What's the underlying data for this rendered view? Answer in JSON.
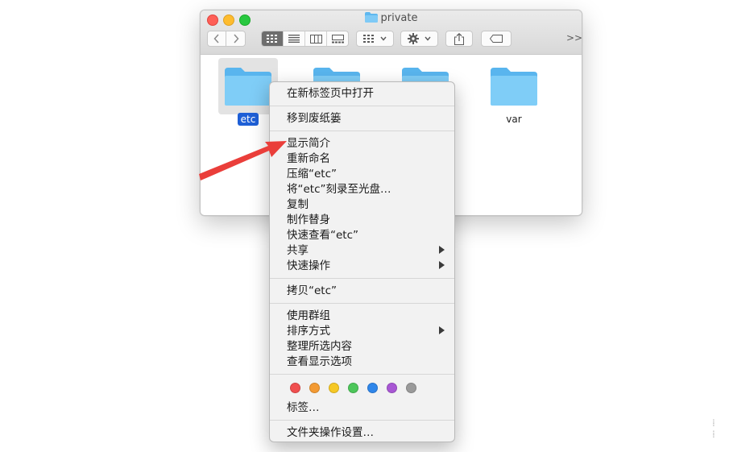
{
  "window": {
    "title": "private",
    "toolbar": {
      "back_icon": "chevron-left-icon",
      "forward_icon": "chevron-right-icon",
      "view_modes": [
        "icon-view-icon",
        "list-view-icon",
        "column-view-icon",
        "gallery-view-icon"
      ],
      "active_view": "icon-view-icon",
      "group_icon": "group-icon",
      "action_icon": "gear-icon",
      "share_icon": "share-icon",
      "tag_icon": "tag-icon",
      "overflow_label": ">>"
    },
    "items": [
      {
        "name": "etc",
        "selected": true
      },
      {
        "name": "",
        "selected": false
      },
      {
        "name": "",
        "selected": false
      },
      {
        "name": "var",
        "selected": false
      }
    ]
  },
  "context_menu": {
    "open_in_new_tab": "在新标签页中打开",
    "move_to_trash": "移到废纸篓",
    "get_info": "显示简介",
    "rename": "重新命名",
    "compress": "压缩“etc”",
    "burn": "将“etc”刻录至光盘…",
    "duplicate": "复制",
    "make_alias": "制作替身",
    "quick_look": "快速查看“etc”",
    "share": "共享",
    "quick_actions": "快速操作",
    "copy": "拷贝“etc”",
    "use_groups": "使用群组",
    "sort_by": "排序方式",
    "clean_up_selection": "整理所选内容",
    "show_view_options": "查看显示选项",
    "tag_colors": [
      "#f04f4f",
      "#f39a33",
      "#f6c825",
      "#4dc65a",
      "#2f86ea",
      "#a857d4",
      "#9a9a9a"
    ],
    "tags": "标签…",
    "folder_actions": "文件夹操作设置…"
  },
  "annotation": {
    "color": "#ea3e3a"
  }
}
